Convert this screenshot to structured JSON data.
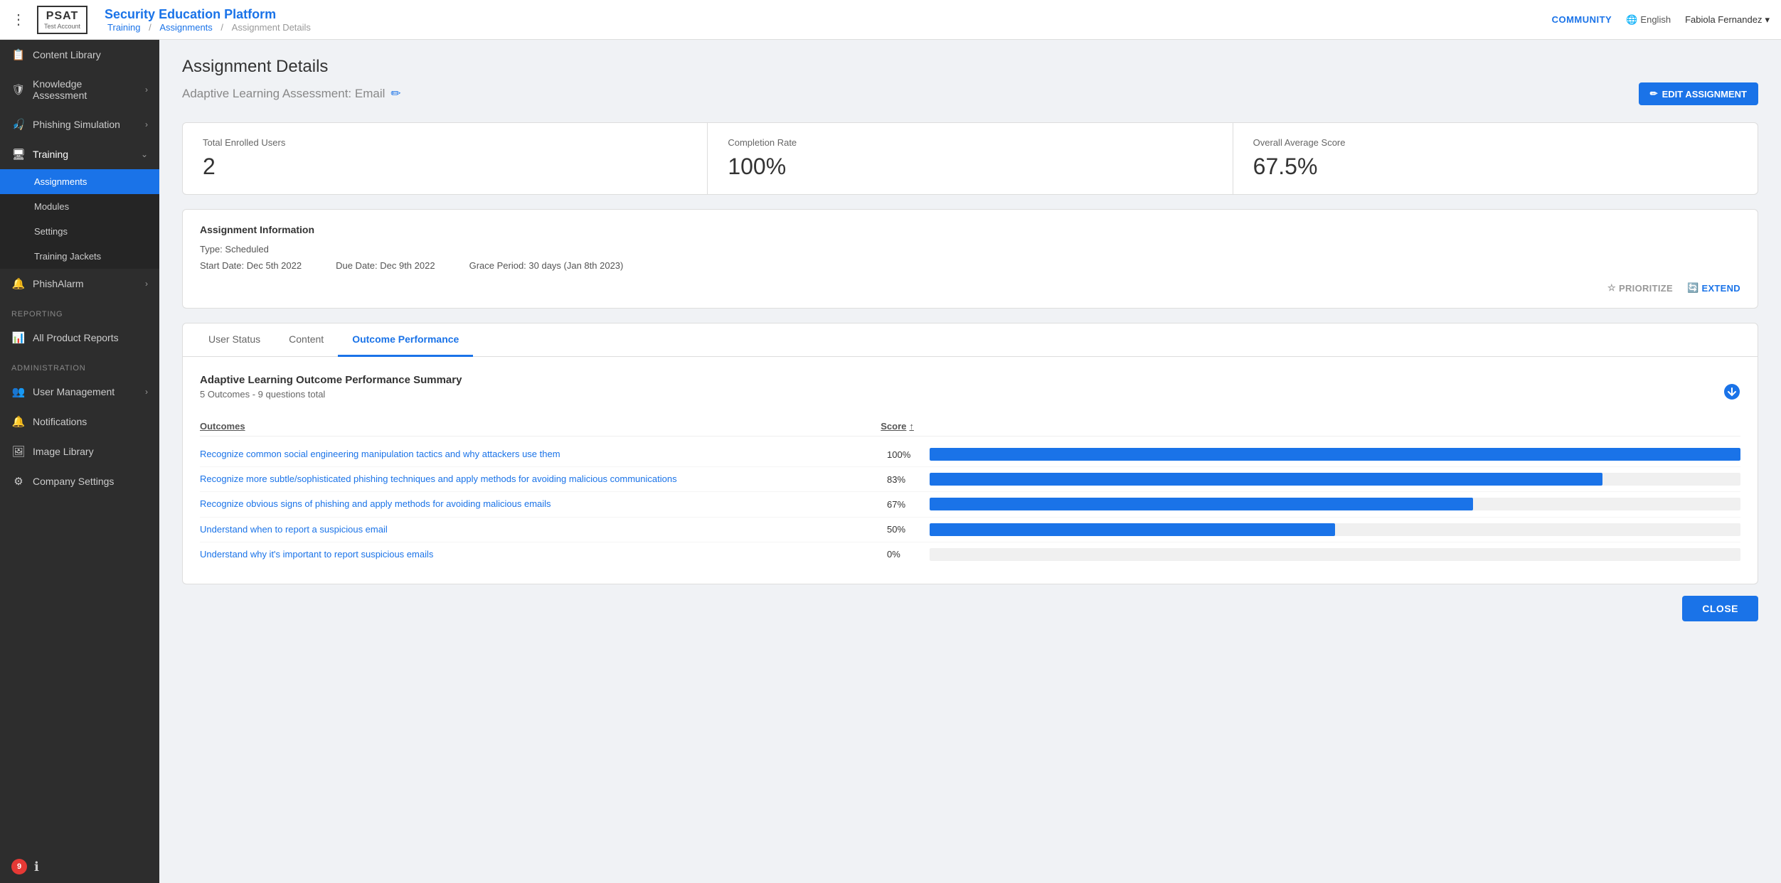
{
  "header": {
    "logo_main": "PSAT",
    "logo_sub": "Test Account",
    "app_title": "Security Education Platform",
    "breadcrumb": {
      "root": "Training",
      "parent": "Assignments",
      "current": "Assignment Details"
    },
    "community_label": "COMMUNITY",
    "language_label": "English",
    "user_label": "Fabiola Fernandez"
  },
  "sidebar": {
    "items": [
      {
        "id": "content-library",
        "icon": "📋",
        "label": "Content Library",
        "has_chevron": false
      },
      {
        "id": "knowledge-assessment",
        "icon": "🛡",
        "label": "Knowledge Assessment",
        "has_chevron": true
      },
      {
        "id": "phishing-simulation",
        "icon": "🎣",
        "label": "Phishing Simulation",
        "has_chevron": true
      },
      {
        "id": "training",
        "icon": "🖥",
        "label": "Training",
        "has_chevron": true,
        "expanded": true
      }
    ],
    "training_sub": [
      {
        "id": "assignments",
        "label": "Assignments",
        "active": true
      },
      {
        "id": "modules",
        "label": "Modules",
        "active": false
      },
      {
        "id": "settings",
        "label": "Settings",
        "active": false
      },
      {
        "id": "training-jackets",
        "label": "Training Jackets",
        "active": false
      }
    ],
    "phish_alarm": {
      "label": "PhishAlarm",
      "icon": "🔔",
      "has_chevron": true
    },
    "reporting_label": "Reporting",
    "reporting_items": [
      {
        "id": "all-product-reports",
        "icon": "📊",
        "label": "All Product Reports"
      }
    ],
    "admin_label": "Administration",
    "admin_items": [
      {
        "id": "user-management",
        "icon": "👥",
        "label": "User Management",
        "has_chevron": true
      },
      {
        "id": "notifications",
        "icon": "🔔",
        "label": "Notifications"
      },
      {
        "id": "image-library",
        "icon": "🖼",
        "label": "Image Library"
      },
      {
        "id": "company-settings",
        "icon": "⚙",
        "label": "Company Settings"
      }
    ],
    "badge_count": "9",
    "help_icon": "?"
  },
  "page": {
    "title": "Assignment Details",
    "subtitle": "Adaptive Learning Assessment: Email",
    "edit_button": "EDIT ASSIGNMENT"
  },
  "stats": [
    {
      "label": "Total Enrolled Users",
      "value": "2"
    },
    {
      "label": "Completion Rate",
      "value": "100%"
    },
    {
      "label": "Overall Average Score",
      "value": "67.5%"
    }
  ],
  "assignment_info": {
    "title": "Assignment Information",
    "type_label": "Type: Scheduled",
    "start_date": "Start Date: Dec 5th 2022",
    "due_date": "Due Date: Dec 9th 2022",
    "grace_period": "Grace Period: 30 days (Jan 8th 2023)",
    "prioritize_label": "PRIORITIZE",
    "extend_label": "EXTEND"
  },
  "tabs": [
    {
      "id": "user-status",
      "label": "User Status",
      "active": false
    },
    {
      "id": "content",
      "label": "Content",
      "active": false
    },
    {
      "id": "outcome-performance",
      "label": "Outcome Performance",
      "active": true
    }
  ],
  "outcome_performance": {
    "title": "Adaptive Learning Outcome Performance Summary",
    "subtitle": "5 Outcomes - 9 questions total",
    "col_outcome": "Outcomes",
    "col_score": "Score",
    "outcomes": [
      {
        "name": "Recognize common social engineering manipulation tactics and why attackers use them",
        "score": "100%",
        "bar_pct": 100
      },
      {
        "name": "Recognize more subtle/sophisticated phishing techniques and apply methods for avoiding malicious communications",
        "score": "83%",
        "bar_pct": 83
      },
      {
        "name": "Recognize obvious signs of phishing and apply methods for avoiding malicious emails",
        "score": "67%",
        "bar_pct": 67
      },
      {
        "name": "Understand when to report a suspicious email",
        "score": "50%",
        "bar_pct": 50
      },
      {
        "name": "Understand why it's important to report suspicious emails",
        "score": "0%",
        "bar_pct": 0
      }
    ]
  },
  "close_button": "CLOSE"
}
